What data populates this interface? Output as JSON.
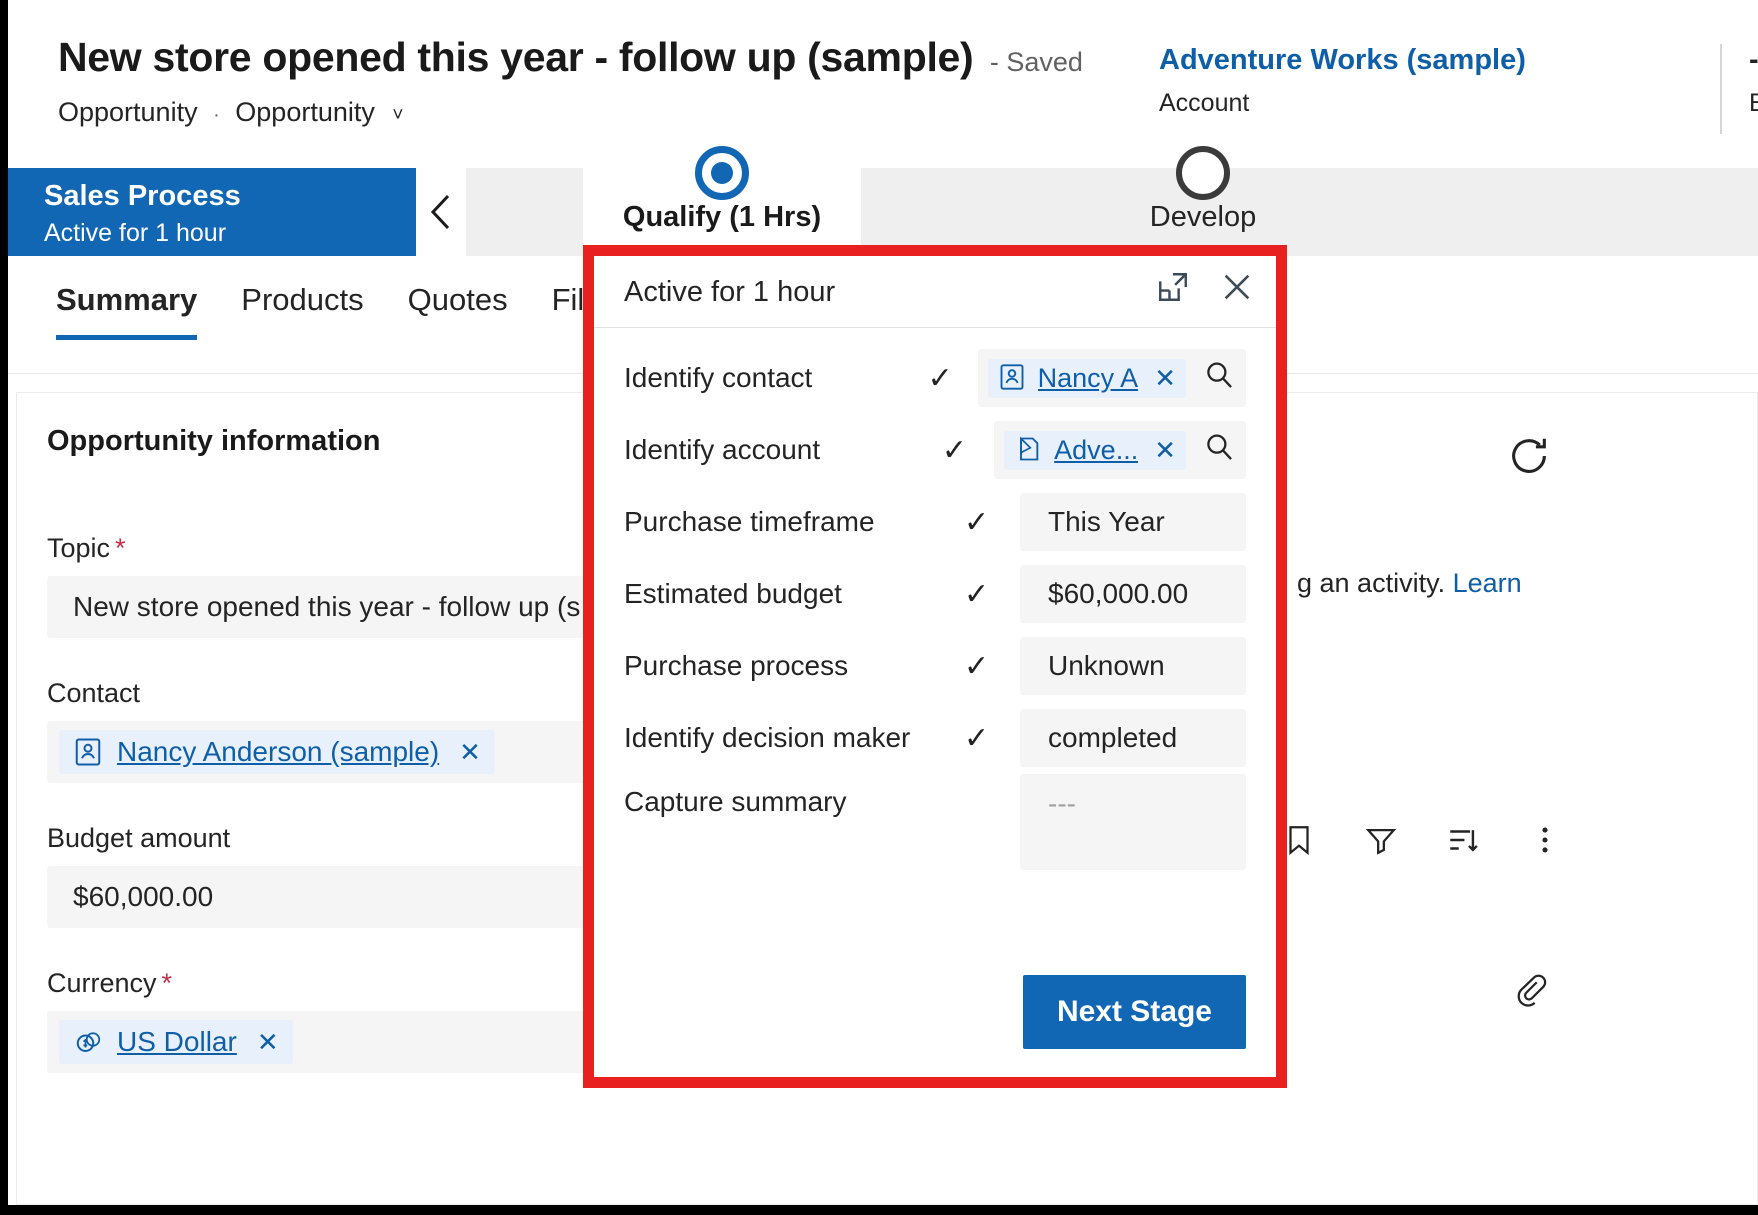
{
  "header": {
    "record_title": "New store opened this year - follow up (sample)",
    "saved_status": "- Saved",
    "breadcrumb_entity": "Opportunity",
    "breadcrumb_form": "Opportunity",
    "breadcrumb_separator": "·",
    "account_name": "Adventure Works (sample)",
    "account_label": "Account",
    "est_value": "---",
    "est_label": "Est"
  },
  "process": {
    "name": "Sales Process",
    "active_for": "Active for 1 hour",
    "stages": [
      {
        "label": "Qualify  (1 Hrs)",
        "state": "active"
      },
      {
        "label": "Develop",
        "state": "upcoming"
      }
    ]
  },
  "tabs": [
    {
      "label": "Summary",
      "active": true
    },
    {
      "label": "Products",
      "active": false
    },
    {
      "label": "Quotes",
      "active": false
    },
    {
      "label": "Fil",
      "active": false
    }
  ],
  "form": {
    "section_title": "Opportunity information",
    "fields": [
      {
        "label": "Topic",
        "required": true,
        "value": "New store opened this year - follow up (s",
        "type": "text"
      },
      {
        "label": "Contact",
        "required": false,
        "value": "Nancy Anderson (sample)",
        "type": "lookup",
        "icon": "contact-icon"
      },
      {
        "label": "Budget amount",
        "required": false,
        "value": "$60,000.00",
        "type": "text"
      },
      {
        "label": "Currency",
        "required": true,
        "value": "US Dollar",
        "type": "lookup",
        "icon": "currency-icon"
      }
    ]
  },
  "timeline": {
    "hint_text": "g an activity.",
    "hint_link": "Learn"
  },
  "flyout": {
    "title": "Active for 1 hour",
    "expand_icon": "open-in-new-window-icon",
    "close_icon": "close-icon",
    "next_stage_label": "Next Stage",
    "steps": [
      {
        "label": "Identify contact",
        "checked": true,
        "value": "Nancy A",
        "type": "lookup",
        "icon": "contact-icon",
        "has_search": true
      },
      {
        "label": "Identify account",
        "checked": true,
        "value": "Adve...",
        "type": "lookup",
        "icon": "account-icon",
        "has_search": true
      },
      {
        "label": "Purchase timeframe",
        "checked": true,
        "value": "This Year",
        "type": "text"
      },
      {
        "label": "Estimated budget",
        "checked": true,
        "value": "$60,000.00",
        "type": "text"
      },
      {
        "label": "Purchase process",
        "checked": true,
        "value": "Unknown",
        "type": "text"
      },
      {
        "label": "Identify decision maker",
        "checked": true,
        "value": "completed",
        "type": "text"
      },
      {
        "label": "Capture summary",
        "checked": false,
        "value": "---",
        "type": "textarea"
      }
    ]
  },
  "colors": {
    "accent_blue": "#1267b4",
    "link_blue": "#0f5ea8",
    "highlight_red": "#e8201f",
    "field_bg": "#f5f5f5",
    "chip_bg": "#e8f0fb"
  }
}
